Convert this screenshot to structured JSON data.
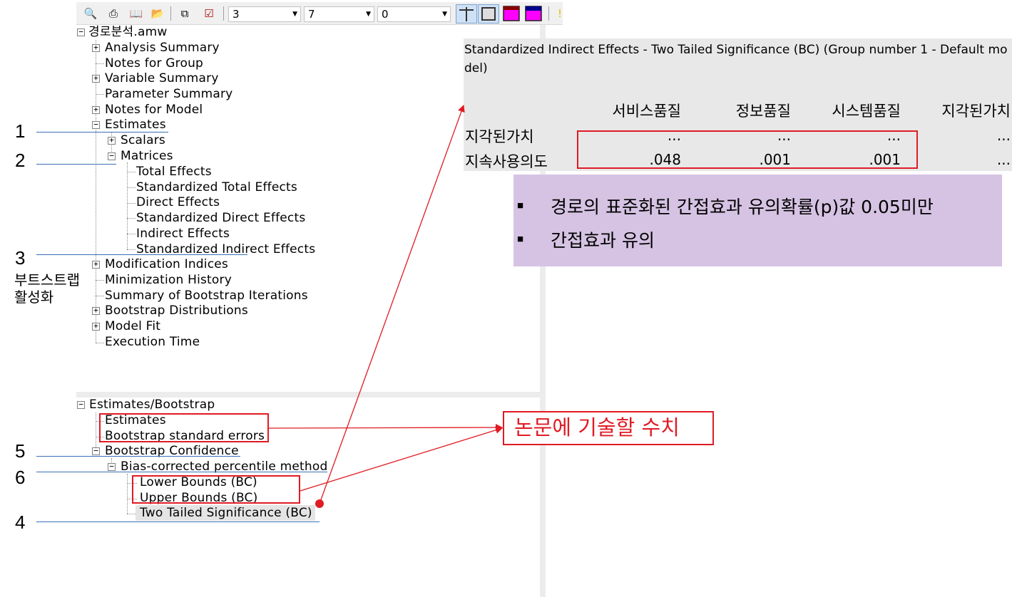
{
  "toolbar": {
    "icons": [
      "print-preview-icon",
      "print-icon",
      "open-book-icon",
      "open-folder-icon",
      "copy-icon",
      "checkbox-icon"
    ],
    "decimals_select": "3",
    "column_width_select": "7",
    "margin_select": "0"
  },
  "tree": {
    "root": "경로분석.amw",
    "analysis_summary": "Analysis Summary",
    "notes_for_group": "Notes for Group",
    "variable_summary": "Variable Summary",
    "parameter_summary": "Parameter Summary",
    "notes_for_model": "Notes for Model",
    "estimates": "Estimates",
    "scalars": "Scalars",
    "matrices": "Matrices",
    "total_effects": "Total Effects",
    "std_total_effects": "Standardized Total Effects",
    "direct_effects": "Direct Effects",
    "std_direct_effects": "Standardized Direct Effects",
    "indirect_effects": "Indirect Effects",
    "std_indirect_effects": "Standardized Indirect Effects",
    "modification_indices": "Modification Indices",
    "minimization_history": "Minimization History",
    "summary_bootstrap": "Summary of Bootstrap Iterations",
    "bootstrap_distributions": "Bootstrap Distributions",
    "model_fit": "Model Fit",
    "execution_time": "Execution Time"
  },
  "tree2": {
    "root": "Estimates/Bootstrap",
    "estimates": "Estimates",
    "bootstrap_se": "Bootstrap standard errors",
    "bootstrap_confidence": "Bootstrap Confidence",
    "bias_corrected": "Bias-corrected percentile method",
    "lower_bounds": "Lower Bounds (BC)",
    "upper_bounds": "Upper Bounds (BC)",
    "two_tailed": "Two Tailed Significance (BC)"
  },
  "annotations": {
    "n1": "1",
    "n2": "2",
    "n3": "3",
    "n4": "4",
    "n5": "5",
    "n6": "6",
    "bootstrap_note_line1": "부트스트랩",
    "bootstrap_note_line2": "활성화",
    "callout": "논문에 기술할 수치"
  },
  "output": {
    "title_line1": "Standardized Indirect Effects - Two Tailed Significance (BC) (Group number 1 - Default mo",
    "title_line2": "del)",
    "columns": [
      "서비스품질",
      "정보품질",
      "시스템품질",
      "지각된가치"
    ],
    "rows": [
      {
        "label": "지각된가치",
        "values": [
          "...",
          "...",
          "...",
          "..."
        ]
      },
      {
        "label": "지속사용의도",
        "values": [
          ".048",
          ".001",
          ".001",
          "..."
        ]
      }
    ]
  },
  "note": {
    "line1": "경로의 표준화된 간접효과 유의확률(p)값 0.05미만",
    "line2": "간접효과 유의"
  },
  "colors": {
    "annotation_red": "#e01b24",
    "annotation_blue": "#3a6fb5",
    "note_background": "#d6c3e3",
    "output_background": "#e8e8e8"
  }
}
